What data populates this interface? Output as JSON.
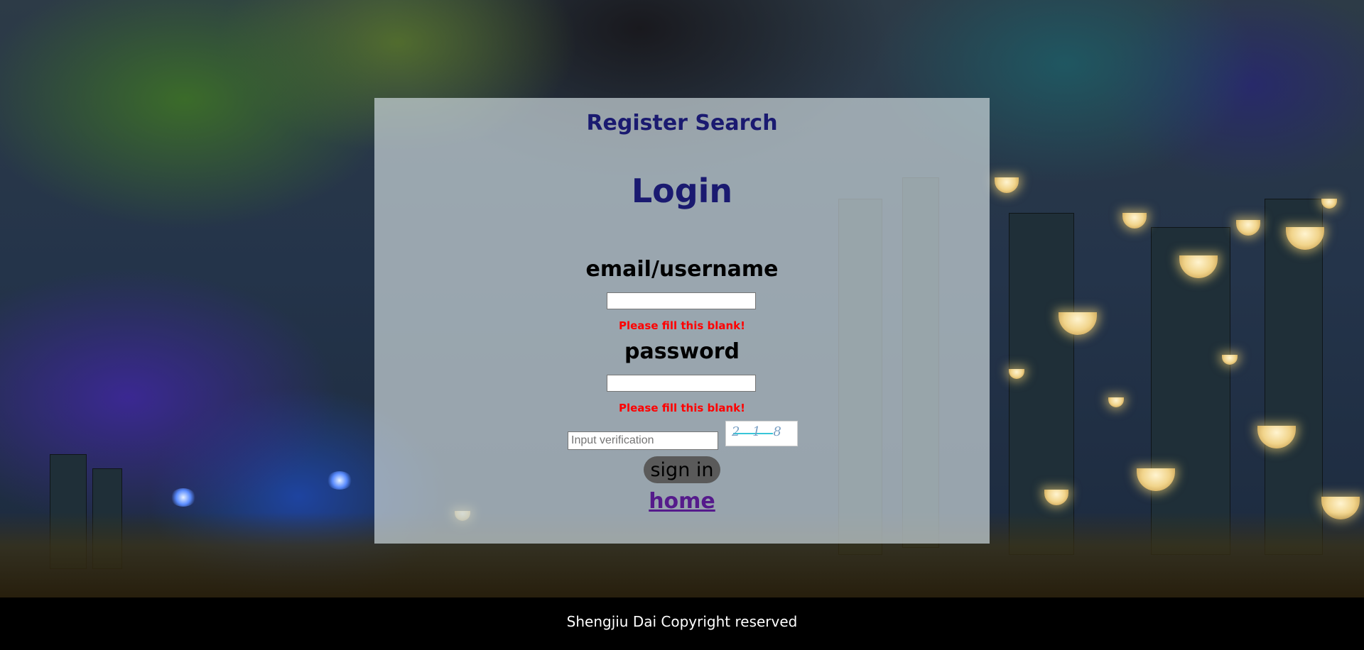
{
  "header": {
    "site_title": "Register Search"
  },
  "login": {
    "title": "Login",
    "username_label": "email/username",
    "username_value": "",
    "username_error": "Please fill this blank!",
    "password_label": "password",
    "password_value": "",
    "password_error": "Please fill this blank!",
    "verification_placeholder": "Input verification",
    "captcha_text": "2 1 8",
    "sign_in_label": "sign in",
    "home_link": "home"
  },
  "footer": {
    "copyright": "Shengjiu Dai Copyright reserved"
  },
  "colors": {
    "title": "#1a1a70",
    "error": "#ff0000",
    "link": "#551a8b",
    "button": "#5a5a5a",
    "footer_bg": "#000000"
  }
}
